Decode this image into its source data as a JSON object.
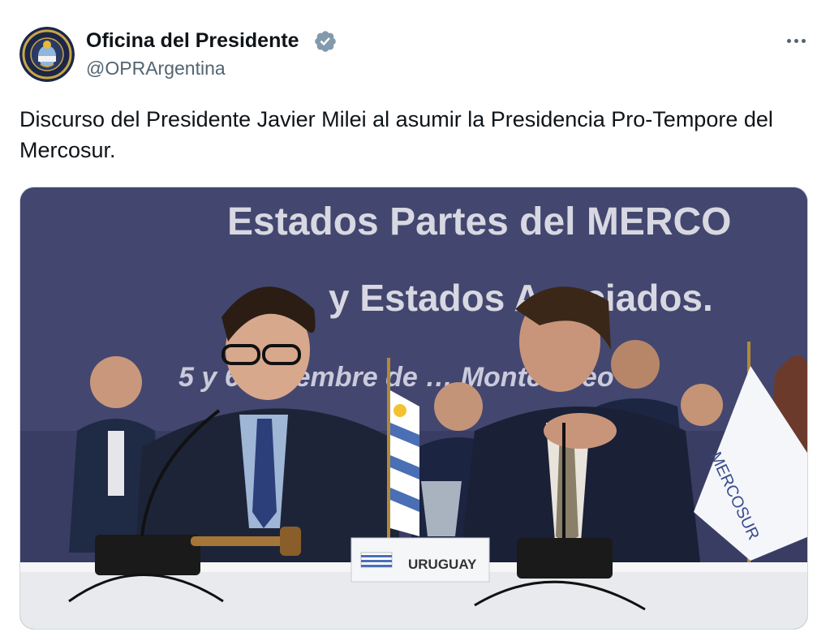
{
  "author": {
    "display_name": "Oficina del Presidente",
    "handle": "@OPRArgentina",
    "verified_icon": "verified-badge-icon",
    "verified_color": "#829aab"
  },
  "tweet": {
    "text": "Discurso del Presidente Javier Milei al asumir la Presidencia Pro-Tempore del Mercosur."
  },
  "media": {
    "banner_line1": "Estados Partes del MERCO",
    "banner_line2": "y Estados Asociados.",
    "banner_line3": "5 y 6 diciembre de … Montevideo",
    "name_card": "URUGUAY",
    "flag_text": "MERCOSUR"
  },
  "colors": {
    "text": "#0f1419",
    "secondary": "#536471",
    "banner_bg": "#3a3d63"
  }
}
